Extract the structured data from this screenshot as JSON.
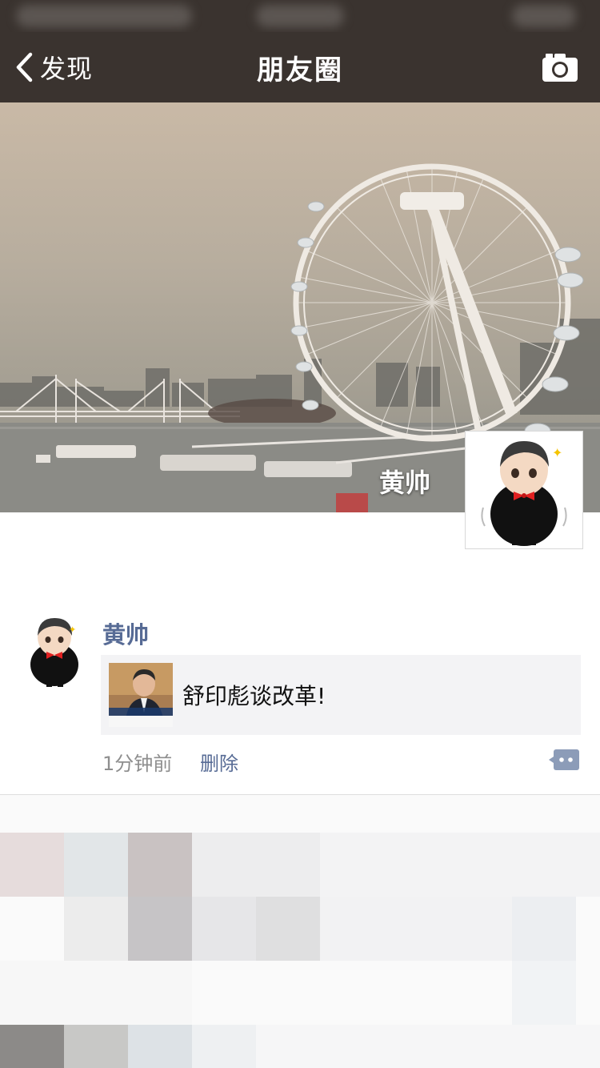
{
  "nav": {
    "back_label": "发现",
    "title": "朋友圈",
    "back_icon": "chevron-left-icon",
    "camera_icon": "camera-icon"
  },
  "cover": {
    "user_name": "黄帅"
  },
  "post": {
    "author": "黄帅",
    "link_title": "舒印彪谈改革!",
    "time": "1分钟前",
    "delete_label": "删除",
    "comment_icon": "comment-icon"
  },
  "colors": {
    "nav_background": "#3a332f",
    "link_blue": "#576b95",
    "link_card_background": "#f3f3f5",
    "meta_gray": "#8e8e8e"
  }
}
